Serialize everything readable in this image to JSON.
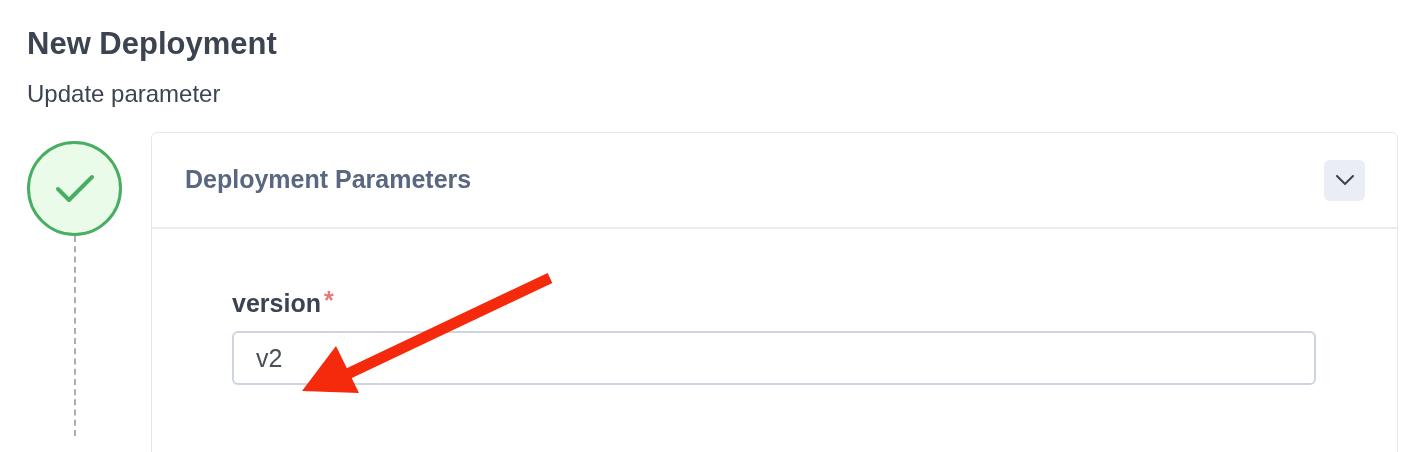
{
  "page": {
    "title": "New Deployment",
    "subtitle": "Update parameter"
  },
  "step": {
    "completed": true
  },
  "card": {
    "title": "Deployment Parameters",
    "expanded": true,
    "fields": [
      {
        "label": "version",
        "required": true,
        "required_mark": "*",
        "value": "v2"
      }
    ]
  },
  "annotation": {
    "kind": "arrow"
  }
}
